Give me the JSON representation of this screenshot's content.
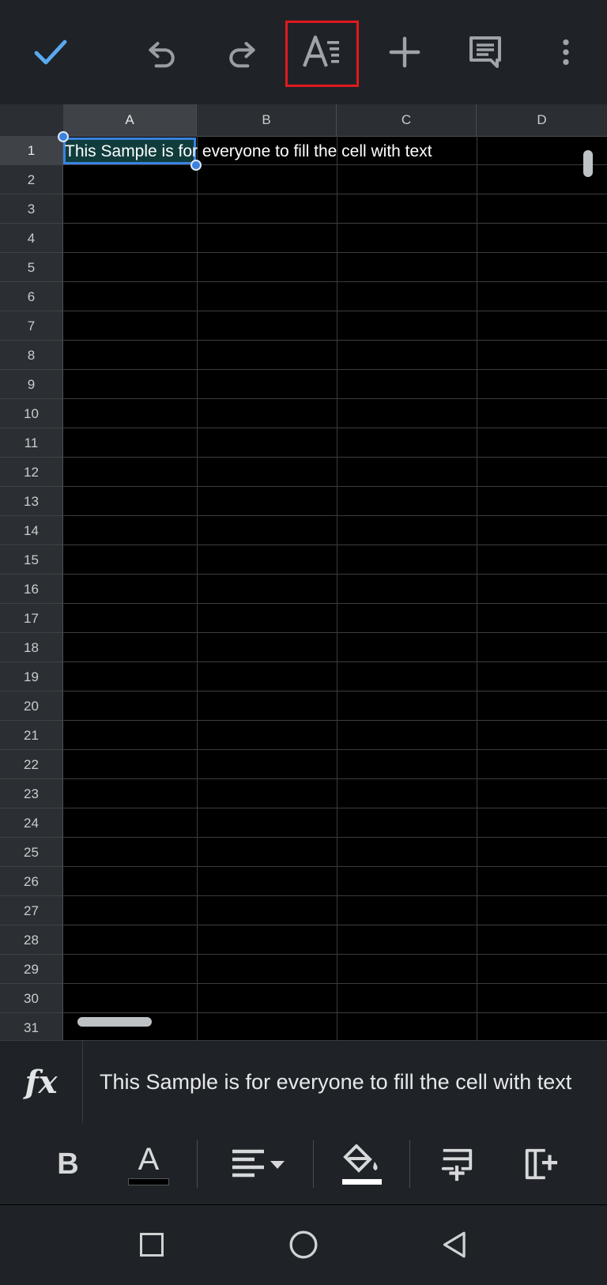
{
  "toolbar": {
    "done_icon": "check-icon",
    "undo_icon": "undo-icon",
    "redo_icon": "redo-icon",
    "format_icon": "text-format-icon",
    "insert_icon": "plus-icon",
    "comment_icon": "comment-icon",
    "more_icon": "more-vert-icon"
  },
  "sheet": {
    "columns": [
      "A",
      "B",
      "C",
      "D"
    ],
    "rows": [
      "1",
      "2",
      "3",
      "4",
      "5",
      "6",
      "7",
      "8",
      "9",
      "10",
      "11",
      "12",
      "13",
      "14",
      "15",
      "16",
      "17",
      "18",
      "19",
      "20",
      "21",
      "22",
      "23",
      "24",
      "25",
      "26",
      "27",
      "28",
      "29",
      "30",
      "31"
    ],
    "cell_a1": "This Sample is for everyone  to fill the cell with text"
  },
  "formula_bar": {
    "fx_label": "fx",
    "value": "This Sample is for everyone  to fill the cell with text"
  },
  "format_bar": {
    "bold_label": "B",
    "text_color_label": "A"
  },
  "colors": {
    "accent": "#3b82e0",
    "highlight_box": "#e0191e",
    "checkmark": "#5aa9f0"
  }
}
